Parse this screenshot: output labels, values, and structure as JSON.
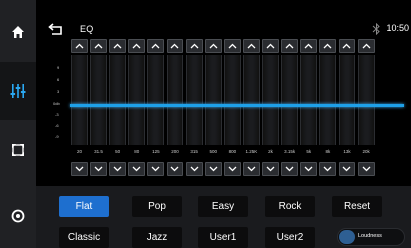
{
  "header": {
    "title": "EQ",
    "clock": "10:50"
  },
  "eq": {
    "db_scale": [
      "9",
      "6",
      "3",
      "0db",
      "-3",
      "-6",
      "-9"
    ],
    "frequencies": [
      "20",
      "31.5",
      "50",
      "80",
      "125",
      "200",
      "315",
      "500",
      "800",
      "1.25K",
      "2k",
      "3.15k",
      "5k",
      "8k",
      "13k",
      "20k"
    ],
    "level_color": "#1ea0e8"
  },
  "presets": {
    "row1": [
      "Flat",
      "Pop",
      "Easy",
      "Rock",
      "Reset"
    ],
    "row2": [
      "Classic",
      "Jazz",
      "User1",
      "User2"
    ],
    "active": "Flat"
  },
  "loudness": {
    "label": "Loudness",
    "state": "off"
  },
  "colors": {
    "accent": "#1e6fcf",
    "sidebar": "#202124"
  }
}
